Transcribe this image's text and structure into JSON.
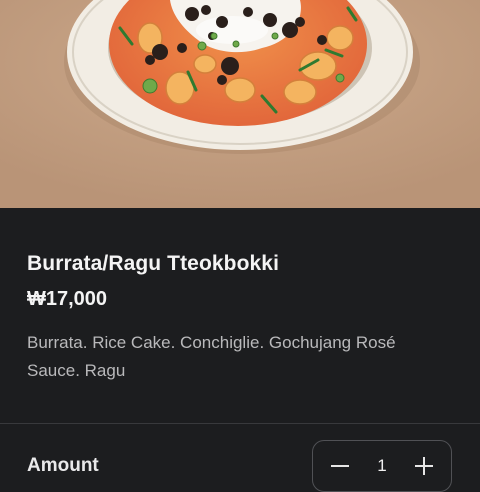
{
  "product": {
    "image_alt": "Bowl of burrata and ragu tteokbokki in rosé sauce",
    "name": "Burrata/Ragu Tteokbokki",
    "price": "₩17,000",
    "description": "Burrata. Rice Cake. Conchiglie. Gochujang Rosé Sauce. Ragu"
  },
  "order": {
    "amount_label": "Amount",
    "quantity": "1",
    "decrement_icon": "minus-icon",
    "increment_icon": "plus-icon"
  },
  "colors": {
    "background": "#1c1d1f",
    "photo_backdrop": "#c4a184",
    "text_primary": "#f4f4f4",
    "text_secondary": "#b9b9bb",
    "border": "#505155"
  }
}
